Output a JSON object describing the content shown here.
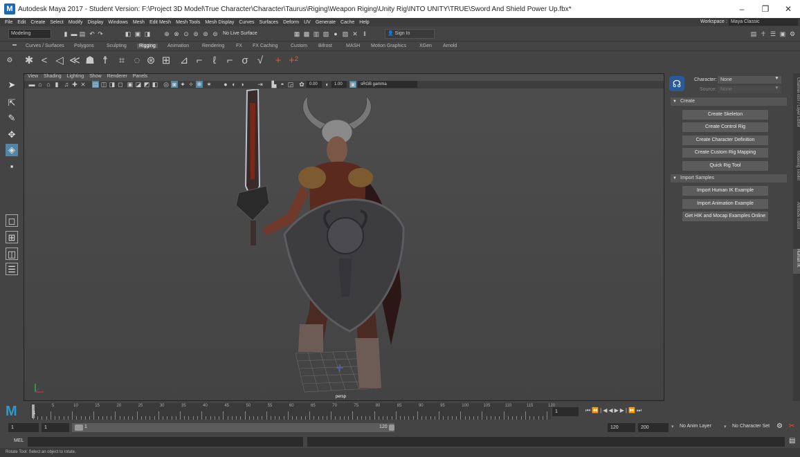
{
  "titlebar": {
    "title": "Autodesk Maya 2017 - Student Version: F:\\Project 3D Model\\True Character\\Character\\Taurus\\Riging\\Weapon Riging\\Unity Rig\\INTO UNITY\\TRUE\\Sword And Shield Power Up.fbx*",
    "logo": "M",
    "minimize": "–",
    "restore": "❐",
    "close": "✕"
  },
  "menubar": [
    "File",
    "Edit",
    "Create",
    "Select",
    "Modify",
    "Display",
    "Windows",
    "Mesh",
    "Edit Mesh",
    "Mesh Tools",
    "Mesh Display",
    "Curves",
    "Surfaces",
    "Deform",
    "UV",
    "Generate",
    "Cache",
    "Help"
  ],
  "workspace": {
    "label": "Workspace :",
    "value": "Maya Classic"
  },
  "status": {
    "mode": "Modeling",
    "live_surface": "No Live Surface",
    "sign_in": "Sign In"
  },
  "shelf_tabs": [
    "Curves / Surfaces",
    "Polygons",
    "Sculpting",
    "Rigging",
    "Animation",
    "Rendering",
    "FX",
    "FX Caching",
    "Custom",
    "Bifrost",
    "MASH",
    "Motion Graphics",
    "XGen",
    "Arnold"
  ],
  "shelf_active": "Rigging",
  "viewport": {
    "menus": [
      "View",
      "Shading",
      "Lighting",
      "Show",
      "Renderer",
      "Panels"
    ],
    "exposure": "0.00",
    "gamma": "1.00",
    "color_space": "sRGB gamma",
    "camera_label": "persp"
  },
  "humanik": {
    "character_label": "Character:",
    "character_value": "None",
    "source_label": "Source:",
    "source_value": "None",
    "create_section": "Create",
    "create_buttons": [
      "Create Skeleton",
      "Create Control Rig",
      "Create Character Definition",
      "Create Custom Rig Mapping",
      "Quick Rig Tool"
    ],
    "import_section": "Import Samples",
    "import_buttons": [
      "Import Human IK Example",
      "Import Animation Example",
      "Get HIK and Mocap Examples Online"
    ]
  },
  "side_tabs": [
    "Channel Box / Layer Editor",
    "Modeling Toolkit",
    "Attribute Editor",
    "Human IK"
  ],
  "timeline": {
    "ticks": [
      "5",
      "10",
      "15",
      "20",
      "25",
      "30",
      "35",
      "40",
      "45",
      "50",
      "55",
      "60",
      "65",
      "70",
      "75",
      "80",
      "85",
      "90",
      "95",
      "100",
      "105",
      "110",
      "115",
      "120"
    ],
    "start_marker": "1",
    "current_frame": "1"
  },
  "range": {
    "start": "1",
    "playback_start": "1",
    "slider_start": "1",
    "slider_end": "120",
    "playback_end": "120",
    "end": "200",
    "anim_layer": "No Anim Layer",
    "character_set": "No Character Set"
  },
  "cmd": {
    "label": "MEL"
  },
  "help_line": "Rotate Tool: Select an object to rotate."
}
